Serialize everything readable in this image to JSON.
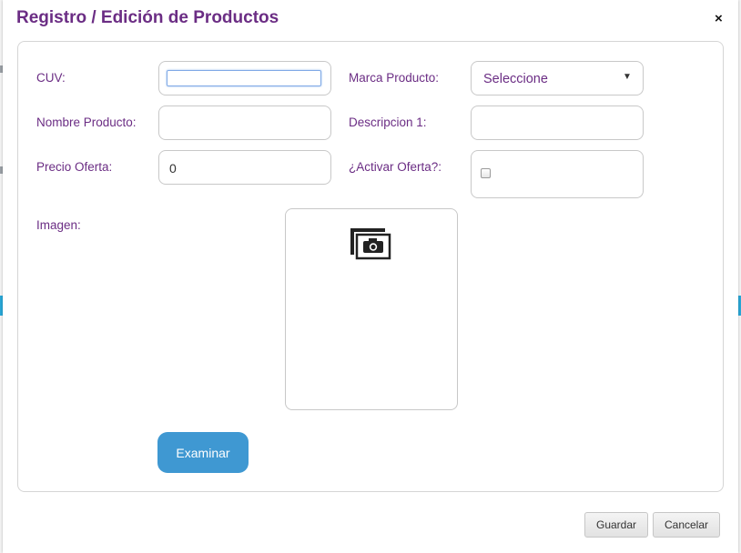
{
  "dialog": {
    "title": "Registro / Edición de Productos",
    "close_label": "×"
  },
  "form": {
    "cuv": {
      "label": "CUV:",
      "value": ""
    },
    "marca": {
      "label": "Marca Producto:",
      "selected": "Seleccione",
      "caret": "▼"
    },
    "nombre": {
      "label": "Nombre Producto:",
      "value": ""
    },
    "descripcion": {
      "label": "Descripcion 1:",
      "value": ""
    },
    "precio": {
      "label": "Precio Oferta:",
      "value": "0"
    },
    "activar": {
      "label": "¿Activar Oferta?:",
      "checked": false
    },
    "imagen": {
      "label": "Imagen:",
      "placeholder_icon": "photo-gallery-camera-icon"
    }
  },
  "buttons": {
    "examinar": "Examinar",
    "guardar": "Guardar",
    "cancelar": "Cancelar"
  },
  "colors": {
    "accent": "#6b2d84",
    "primary_button": "#3f98d2"
  }
}
